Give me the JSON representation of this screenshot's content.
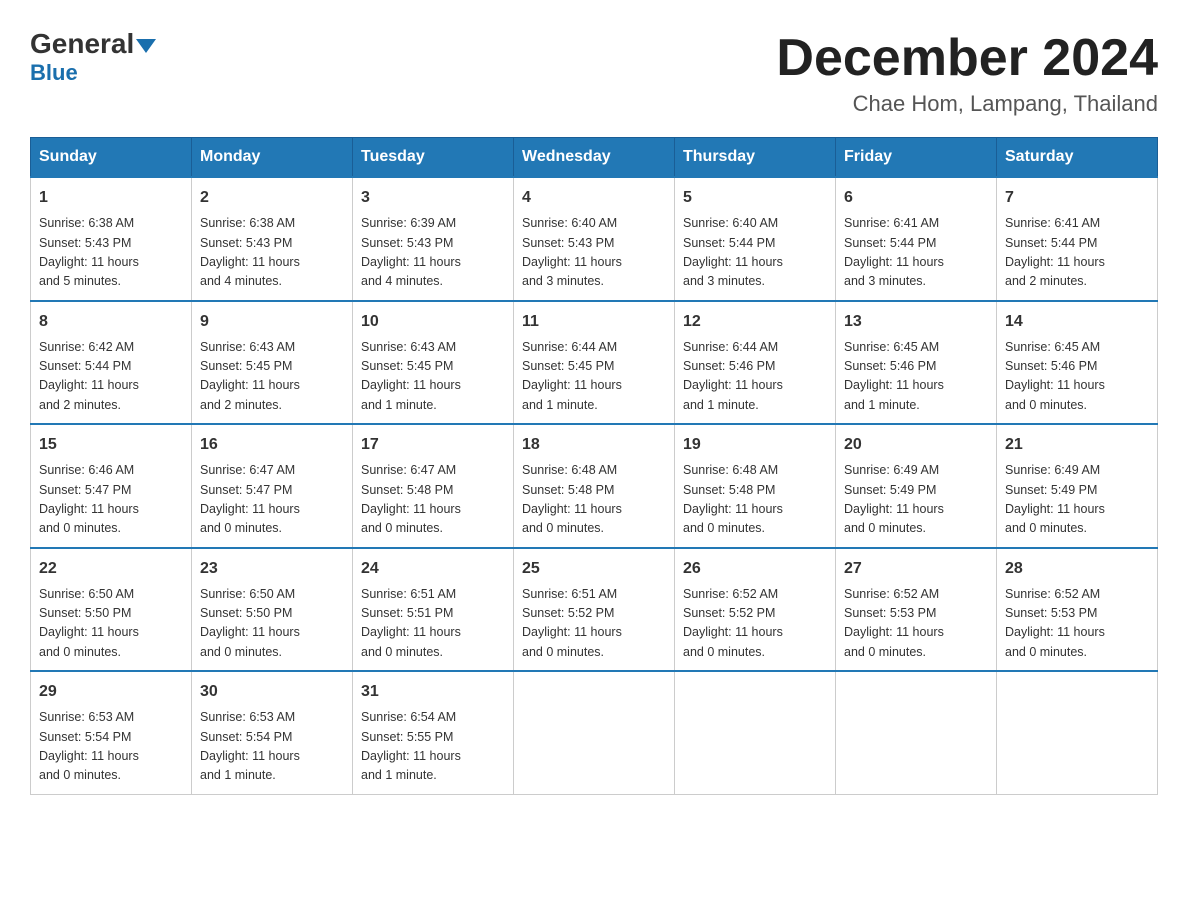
{
  "header": {
    "logo_general": "General",
    "logo_blue": "Blue",
    "calendar_title": "December 2024",
    "calendar_subtitle": "Chae Hom, Lampang, Thailand"
  },
  "days_of_week": [
    "Sunday",
    "Monday",
    "Tuesday",
    "Wednesday",
    "Thursday",
    "Friday",
    "Saturday"
  ],
  "weeks": [
    [
      {
        "day": "1",
        "sunrise": "6:38 AM",
        "sunset": "5:43 PM",
        "daylight": "11 hours and 5 minutes."
      },
      {
        "day": "2",
        "sunrise": "6:38 AM",
        "sunset": "5:43 PM",
        "daylight": "11 hours and 4 minutes."
      },
      {
        "day": "3",
        "sunrise": "6:39 AM",
        "sunset": "5:43 PM",
        "daylight": "11 hours and 4 minutes."
      },
      {
        "day": "4",
        "sunrise": "6:40 AM",
        "sunset": "5:43 PM",
        "daylight": "11 hours and 3 minutes."
      },
      {
        "day": "5",
        "sunrise": "6:40 AM",
        "sunset": "5:44 PM",
        "daylight": "11 hours and 3 minutes."
      },
      {
        "day": "6",
        "sunrise": "6:41 AM",
        "sunset": "5:44 PM",
        "daylight": "11 hours and 3 minutes."
      },
      {
        "day": "7",
        "sunrise": "6:41 AM",
        "sunset": "5:44 PM",
        "daylight": "11 hours and 2 minutes."
      }
    ],
    [
      {
        "day": "8",
        "sunrise": "6:42 AM",
        "sunset": "5:44 PM",
        "daylight": "11 hours and 2 minutes."
      },
      {
        "day": "9",
        "sunrise": "6:43 AM",
        "sunset": "5:45 PM",
        "daylight": "11 hours and 2 minutes."
      },
      {
        "day": "10",
        "sunrise": "6:43 AM",
        "sunset": "5:45 PM",
        "daylight": "11 hours and 1 minute."
      },
      {
        "day": "11",
        "sunrise": "6:44 AM",
        "sunset": "5:45 PM",
        "daylight": "11 hours and 1 minute."
      },
      {
        "day": "12",
        "sunrise": "6:44 AM",
        "sunset": "5:46 PM",
        "daylight": "11 hours and 1 minute."
      },
      {
        "day": "13",
        "sunrise": "6:45 AM",
        "sunset": "5:46 PM",
        "daylight": "11 hours and 1 minute."
      },
      {
        "day": "14",
        "sunrise": "6:45 AM",
        "sunset": "5:46 PM",
        "daylight": "11 hours and 0 minutes."
      }
    ],
    [
      {
        "day": "15",
        "sunrise": "6:46 AM",
        "sunset": "5:47 PM",
        "daylight": "11 hours and 0 minutes."
      },
      {
        "day": "16",
        "sunrise": "6:47 AM",
        "sunset": "5:47 PM",
        "daylight": "11 hours and 0 minutes."
      },
      {
        "day": "17",
        "sunrise": "6:47 AM",
        "sunset": "5:48 PM",
        "daylight": "11 hours and 0 minutes."
      },
      {
        "day": "18",
        "sunrise": "6:48 AM",
        "sunset": "5:48 PM",
        "daylight": "11 hours and 0 minutes."
      },
      {
        "day": "19",
        "sunrise": "6:48 AM",
        "sunset": "5:48 PM",
        "daylight": "11 hours and 0 minutes."
      },
      {
        "day": "20",
        "sunrise": "6:49 AM",
        "sunset": "5:49 PM",
        "daylight": "11 hours and 0 minutes."
      },
      {
        "day": "21",
        "sunrise": "6:49 AM",
        "sunset": "5:49 PM",
        "daylight": "11 hours and 0 minutes."
      }
    ],
    [
      {
        "day": "22",
        "sunrise": "6:50 AM",
        "sunset": "5:50 PM",
        "daylight": "11 hours and 0 minutes."
      },
      {
        "day": "23",
        "sunrise": "6:50 AM",
        "sunset": "5:50 PM",
        "daylight": "11 hours and 0 minutes."
      },
      {
        "day": "24",
        "sunrise": "6:51 AM",
        "sunset": "5:51 PM",
        "daylight": "11 hours and 0 minutes."
      },
      {
        "day": "25",
        "sunrise": "6:51 AM",
        "sunset": "5:52 PM",
        "daylight": "11 hours and 0 minutes."
      },
      {
        "day": "26",
        "sunrise": "6:52 AM",
        "sunset": "5:52 PM",
        "daylight": "11 hours and 0 minutes."
      },
      {
        "day": "27",
        "sunrise": "6:52 AM",
        "sunset": "5:53 PM",
        "daylight": "11 hours and 0 minutes."
      },
      {
        "day": "28",
        "sunrise": "6:52 AM",
        "sunset": "5:53 PM",
        "daylight": "11 hours and 0 minutes."
      }
    ],
    [
      {
        "day": "29",
        "sunrise": "6:53 AM",
        "sunset": "5:54 PM",
        "daylight": "11 hours and 0 minutes."
      },
      {
        "day": "30",
        "sunrise": "6:53 AM",
        "sunset": "5:54 PM",
        "daylight": "11 hours and 1 minute."
      },
      {
        "day": "31",
        "sunrise": "6:54 AM",
        "sunset": "5:55 PM",
        "daylight": "11 hours and 1 minute."
      },
      null,
      null,
      null,
      null
    ]
  ],
  "labels": {
    "sunrise": "Sunrise:",
    "sunset": "Sunset:",
    "daylight": "Daylight:"
  }
}
